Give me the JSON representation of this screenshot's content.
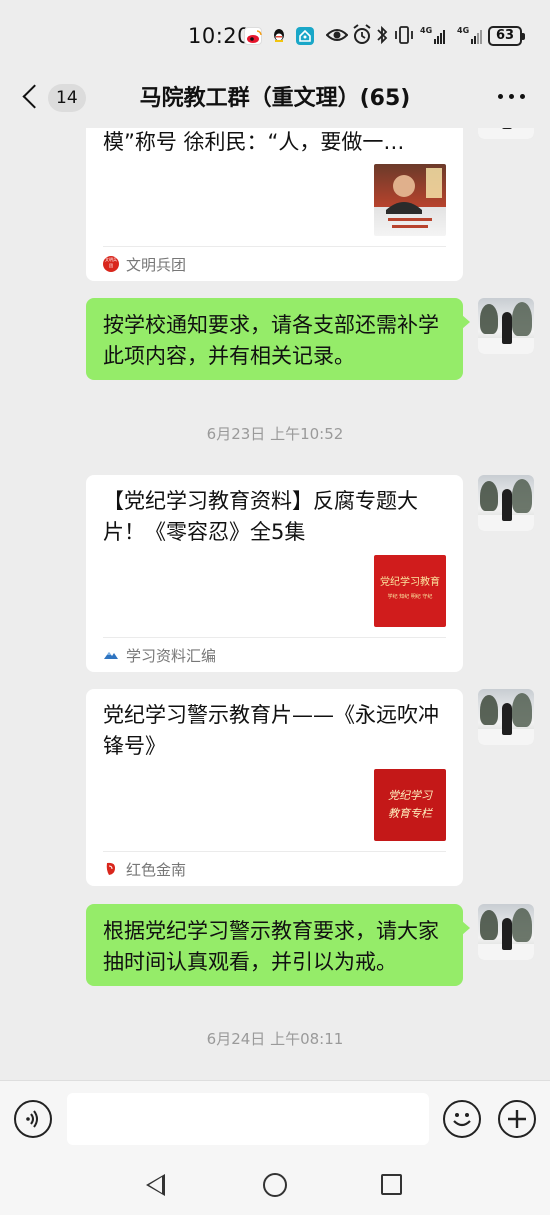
{
  "status_bar": {
    "time": "10:20",
    "network_1": "4G",
    "network_2": "4G",
    "battery": "63"
  },
  "header": {
    "unread_count": "14",
    "title": "马院教工群（重文理）(65)"
  },
  "messages": {
    "card0": {
      "title": "模”称号  徐利民：“人，要做一…",
      "source": "文明兵团",
      "source_icon_text": "文明兵团",
      "thumb_icon": "portrait-thumbnail"
    },
    "bubble1": {
      "text": "按学校通知要求，请各支部还需补学此项内容，并有相关记录。"
    },
    "time1": "6月23日 上午10:52",
    "card2": {
      "title": "【党纪学习教育资料】反腐专题大片！《零容忍》全5集",
      "source": "学习资料汇编",
      "thumb_title": "党纪学习教育",
      "thumb_sub": "学纪 知纪 明纪 守纪"
    },
    "card3": {
      "title": "党纪学习警示教育片——《永远吹冲锋号》",
      "source": "红色金南",
      "thumb_title": "党纪学习",
      "thumb_sub": "教育专栏"
    },
    "bubble4": {
      "text": "根据党纪学习警示教育要求，请大家抽时间认真观看，并引以为戒。"
    },
    "time2": "6月24日 上午08:11"
  },
  "input": {
    "value": ""
  },
  "colors": {
    "background": "#ededed",
    "bubble_green": "#95ec69",
    "card_red": "#d01c1c"
  }
}
